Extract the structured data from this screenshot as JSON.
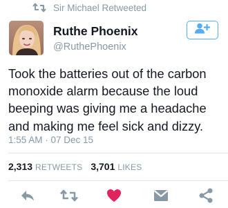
{
  "retweet_context": {
    "icon": "retweet-icon",
    "text": "Sir Michael Retweeted"
  },
  "author": {
    "name": "Ruthe Phoenix",
    "handle": "@RuthePhoenix",
    "avatar": "avatar-photo"
  },
  "follow_button": {
    "icon": "follow-user-plus-icon",
    "color": "#55acee"
  },
  "tweet": {
    "text": "Took the batteries out of the carbon monoxide alarm because the loud beeping was giving me a headache and making me feel sick and dizzy.",
    "timestamp": "1:55 AM · 07 Dec 15"
  },
  "stats": {
    "retweets_count": "2,313",
    "retweets_label": "RETWEETS",
    "likes_count": "3,701",
    "likes_label": "LIKES"
  },
  "actions": [
    {
      "name": "reply",
      "icon": "reply-icon",
      "color": "#8899a6"
    },
    {
      "name": "retweet",
      "icon": "retweet-icon",
      "color": "#8899a6"
    },
    {
      "name": "like",
      "icon": "heart-icon",
      "color": "#e0245e"
    },
    {
      "name": "message",
      "icon": "direct-message-icon",
      "color": "#8899a6"
    },
    {
      "name": "share",
      "icon": "share-icon",
      "color": "#8899a6"
    }
  ],
  "colors": {
    "accent": "#55acee",
    "text": "#141823",
    "muted": "#8899a6",
    "like": "#e0245e",
    "divider": "#e1e8ed"
  }
}
